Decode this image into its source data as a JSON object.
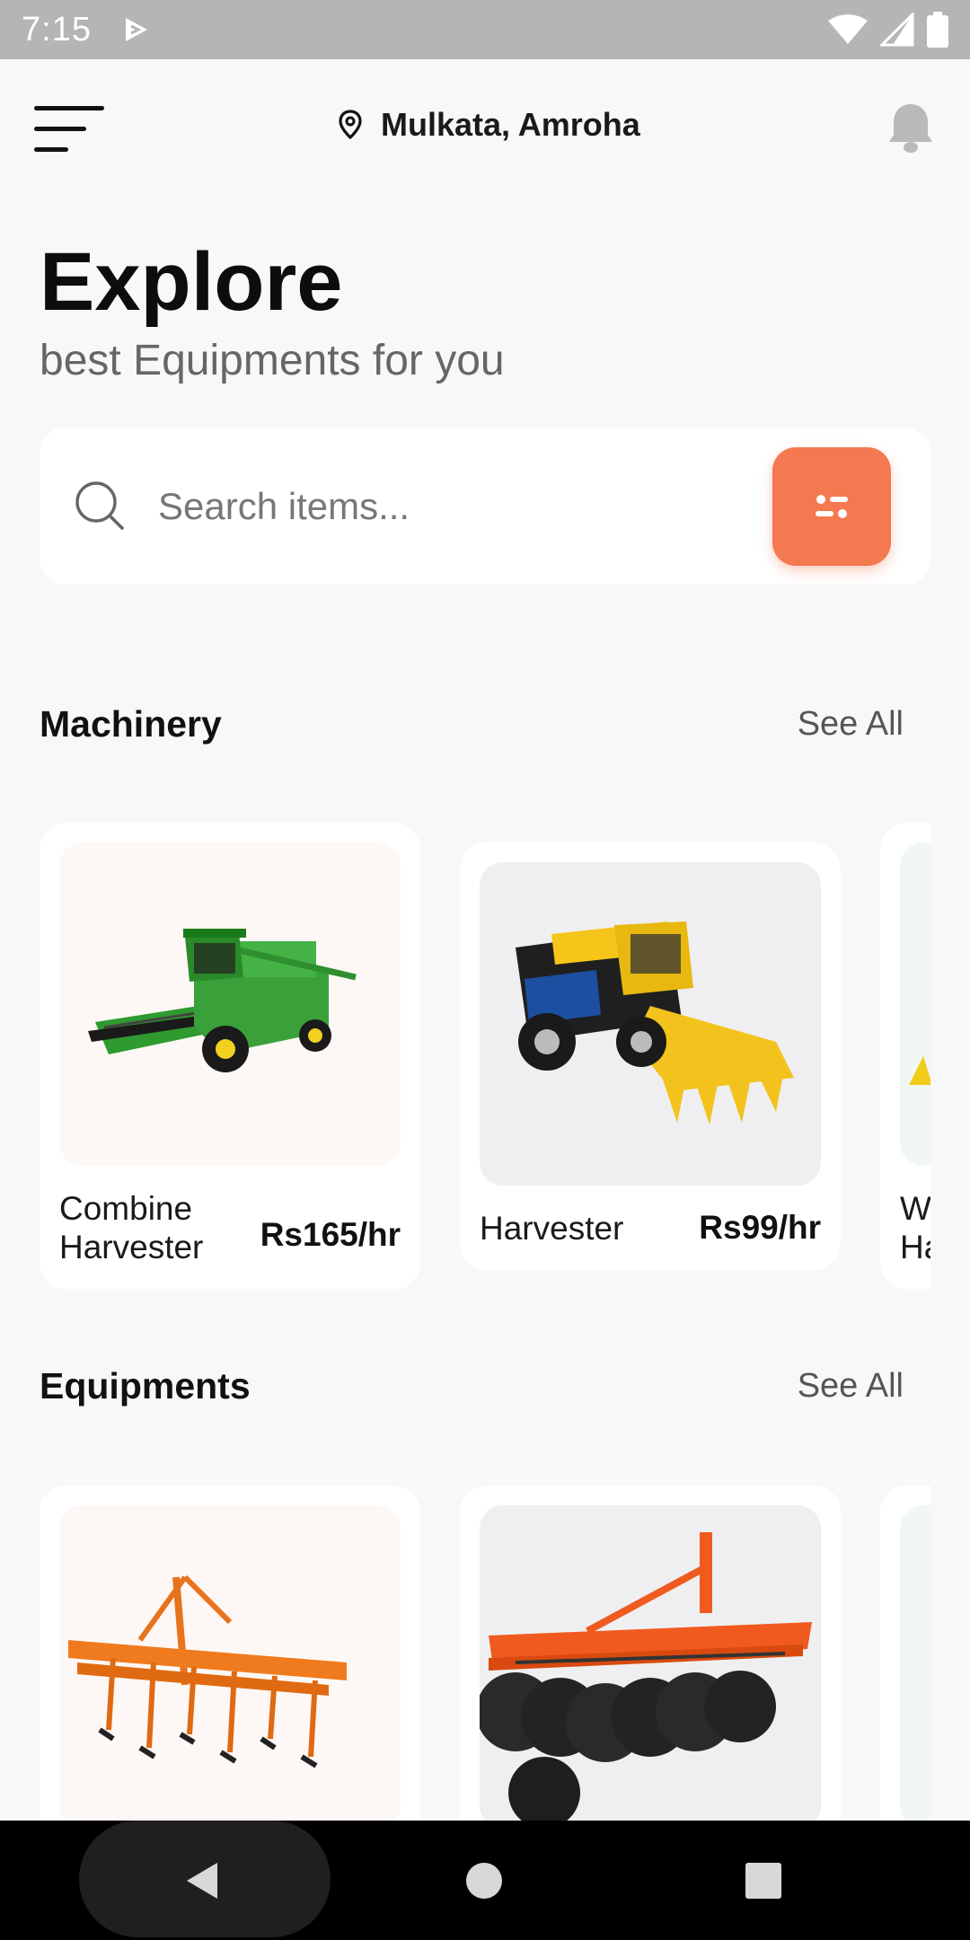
{
  "status": {
    "time": "7:15"
  },
  "header": {
    "location": "Mulkata, Amroha"
  },
  "hero": {
    "title": "Explore",
    "subtitle": "best Equipments for you"
  },
  "search": {
    "placeholder": "Search items..."
  },
  "sections": [
    {
      "title": "Machinery",
      "see_all": "See All",
      "items": [
        {
          "name": "Combine Harvester",
          "price": "Rs165/hr"
        },
        {
          "name": "Harvester",
          "price": "Rs99/hr"
        },
        {
          "name": "W Ha",
          "price": ""
        }
      ]
    },
    {
      "title": "Equipments",
      "see_all": "See All"
    }
  ],
  "colors": {
    "accent": "#f47850",
    "background": "#f8f8fb",
    "card": "#ffffff"
  }
}
